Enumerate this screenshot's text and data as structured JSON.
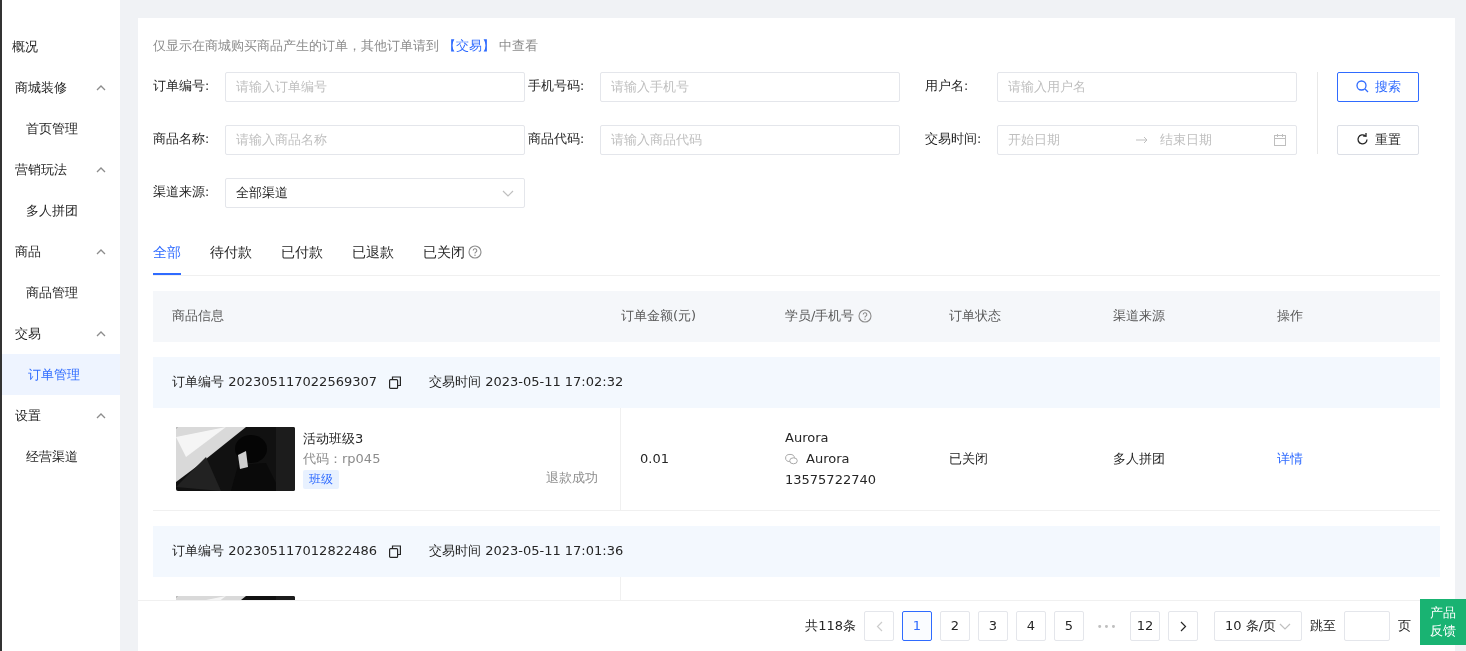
{
  "sidebar": {
    "items": [
      {
        "label": "概况",
        "kind": "link",
        "selected": false
      },
      {
        "label": "商城装修",
        "kind": "group",
        "expanded": true,
        "children": [
          {
            "label": "首页管理",
            "selected": false
          }
        ]
      },
      {
        "label": "营销玩法",
        "kind": "group",
        "expanded": true,
        "children": [
          {
            "label": "多人拼团",
            "selected": false
          }
        ]
      },
      {
        "label": "商品",
        "kind": "group",
        "expanded": true,
        "children": [
          {
            "label": "商品管理",
            "selected": false
          }
        ]
      },
      {
        "label": "交易",
        "kind": "group",
        "expanded": true,
        "children": [
          {
            "label": "订单管理",
            "selected": true
          }
        ]
      },
      {
        "label": "设置",
        "kind": "group",
        "expanded": true,
        "children": [
          {
            "label": "经营渠道",
            "selected": false
          }
        ]
      }
    ]
  },
  "notice": {
    "before": "仅显示在商城购买商品产生的订单，其他订单请到",
    "link": "【交易】",
    "after": "中查看"
  },
  "filters": [
    {
      "label": "订单编号:",
      "kind": "input",
      "placeholder": "请输入订单编号"
    },
    {
      "label": "手机号码:",
      "kind": "input",
      "placeholder": "请输入手机号"
    },
    {
      "label": "用户名:",
      "kind": "input",
      "placeholder": "请输入用户名"
    },
    {
      "label": "商品名称:",
      "kind": "input",
      "placeholder": "请输入商品名称"
    },
    {
      "label": "商品代码:",
      "kind": "input",
      "placeholder": "请输入商品代码"
    },
    {
      "label": "交易时间:",
      "kind": "date_range",
      "start_placeholder": "开始日期",
      "end_placeholder": "结束日期"
    },
    {
      "label": "渠道来源:",
      "kind": "select",
      "value": "全部渠道"
    }
  ],
  "buttons": [
    {
      "label": "搜索",
      "kind": "primary"
    },
    {
      "label": "重置",
      "kind": "default"
    }
  ],
  "tabs": [
    {
      "label": "全部",
      "selected": true
    },
    {
      "label": "待付款",
      "selected": false
    },
    {
      "label": "已付款",
      "selected": false
    },
    {
      "label": "已退款",
      "selected": false
    },
    {
      "label": "已关闭",
      "selected": false,
      "help": true
    }
  ],
  "table": {
    "columns": [
      {
        "label": "商品信息"
      },
      {
        "label": "订单金额(元)"
      },
      {
        "label": "学员/手机号",
        "help": true
      },
      {
        "label": "订单状态"
      },
      {
        "label": "渠道来源"
      },
      {
        "label": "操作"
      }
    ],
    "orders": [
      {
        "order_no": "订单编号 202305117022569307",
        "time": "交易时间 2023-05-11 17:02:32",
        "product": {
          "kind": "picture",
          "name": "活动班级3",
          "code": "代码：rp045",
          "tag": "班级",
          "refund": "退款成功"
        },
        "amount": "0.01",
        "buyer": {
          "name": "Aurora",
          "wechat": "Aurora",
          "phone": "13575722740"
        },
        "status": "已关闭",
        "channel": "多人拼团",
        "action": "详情"
      },
      {
        "order_no": "订单编号 202305117012822486",
        "time": "交易时间 2023-05-11 17:01:36"
      }
    ]
  },
  "pagination": {
    "total": "共118条",
    "prev_disabled": true,
    "pages": [
      {
        "label": "1",
        "selected": true
      },
      {
        "label": "2",
        "selected": false
      },
      {
        "label": "3",
        "selected": false
      },
      {
        "label": "4",
        "selected": false
      },
      {
        "label": "5",
        "selected": false
      },
      {
        "label": "•••",
        "kind": "ellipsis"
      },
      {
        "label": "12",
        "selected": false
      }
    ],
    "page_size": "10 条/页",
    "jump_label": "跳至",
    "page_unit": "页"
  },
  "feedback": "产品反馈"
}
